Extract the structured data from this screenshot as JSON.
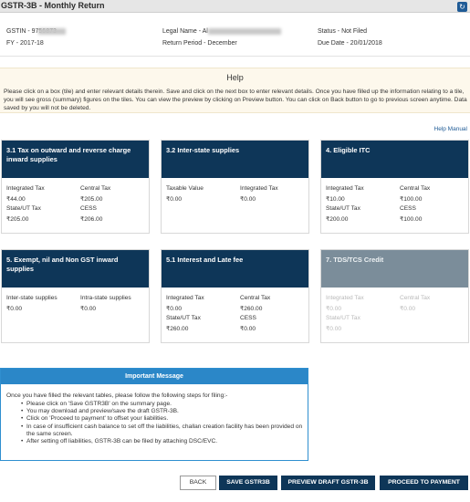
{
  "titlebar": {
    "title": "GSTR-3B - Monthly Return",
    "refresh_icon": "refresh-icon"
  },
  "info": {
    "gstin": "GSTIN - 97",
    "gstin_tail": "56873",
    "fy": "FY - 2017-18",
    "legal_name": "Legal Name - Al",
    "return_period": "Return Period - December",
    "status": "Status - Not Filed",
    "due_date": "Due Date - 20/01/2018"
  },
  "help": {
    "title": "Help",
    "text": "Please click on a box (tile) and enter relevant details therein. Save and click on the next box to enter relevant details. Once you have filled up the information relating to a tile, you will see gross (summary) figures on the tiles. You can view the preview by clicking on Preview button. You can click on Back button to go to previous screen anytime. Data saved by you will not be deleted.",
    "manual_link": "Help Manual"
  },
  "tiles": [
    {
      "title": "3.1 Tax on outward and reverse charge inward supplies",
      "rows": [
        [
          "Integrated Tax",
          "Central Tax"
        ],
        [
          "₹44.00",
          "₹205.00"
        ],
        [
          "State/UT Tax",
          "CESS"
        ],
        [
          "₹205.00",
          "₹206.00"
        ]
      ]
    },
    {
      "title": "3.2 Inter-state supplies",
      "rows": [
        [
          "Taxable Value",
          "Integrated Tax"
        ],
        [
          "₹0.00",
          "₹0.00"
        ]
      ]
    },
    {
      "title": "4. Eligible ITC",
      "rows": [
        [
          "Integrated Tax",
          "Central Tax"
        ],
        [
          "₹10.00",
          "₹100.00"
        ],
        [
          "State/UT Tax",
          "CESS"
        ],
        [
          "₹200.00",
          "₹100.00"
        ]
      ]
    },
    {
      "title": "5. Exempt, nil and Non GST inward supplies",
      "rows": [
        [
          "Inter-state supplies",
          "Intra-state supplies"
        ],
        [
          "₹0.00",
          "₹0.00"
        ]
      ]
    },
    {
      "title": "5.1 Interest and Late fee",
      "rows": [
        [
          "Integrated Tax",
          "Central Tax"
        ],
        [
          "₹0.00",
          "₹260.00"
        ],
        [
          "State/UT Tax",
          "CESS"
        ],
        [
          "₹260.00",
          "₹0.00"
        ]
      ]
    },
    {
      "title": "7. TDS/TCS Credit",
      "rows": [
        [
          "Integrated Tax",
          "Central Tax"
        ],
        [
          "₹0.00",
          "₹0.00"
        ],
        [
          "State/UT Tax",
          ""
        ],
        [
          "₹0.00",
          ""
        ]
      ]
    }
  ],
  "important": {
    "title": "Important Message",
    "intro": "Once you have filled the relevant tables, please follow the following steps for filing:-",
    "steps": [
      "Please click on 'Save GSTR3B' on the summary page.",
      "You may download and preview/save the draft GSTR-3B.",
      "Click on 'Proceed to payment' to offset your liabilities.",
      "In case of insufficient cash balance to set off the liabilities, challan creation facility has been provided on the same screen.",
      "After setting off liabilities, GSTR-3B can be filed by attaching DSC/EVC."
    ]
  },
  "buttons": {
    "back": "BACK",
    "save": "SAVE GSTR3B",
    "preview": "PREVIEW DRAFT GSTR-3B",
    "proceed": "PROCEED TO PAYMENT"
  }
}
